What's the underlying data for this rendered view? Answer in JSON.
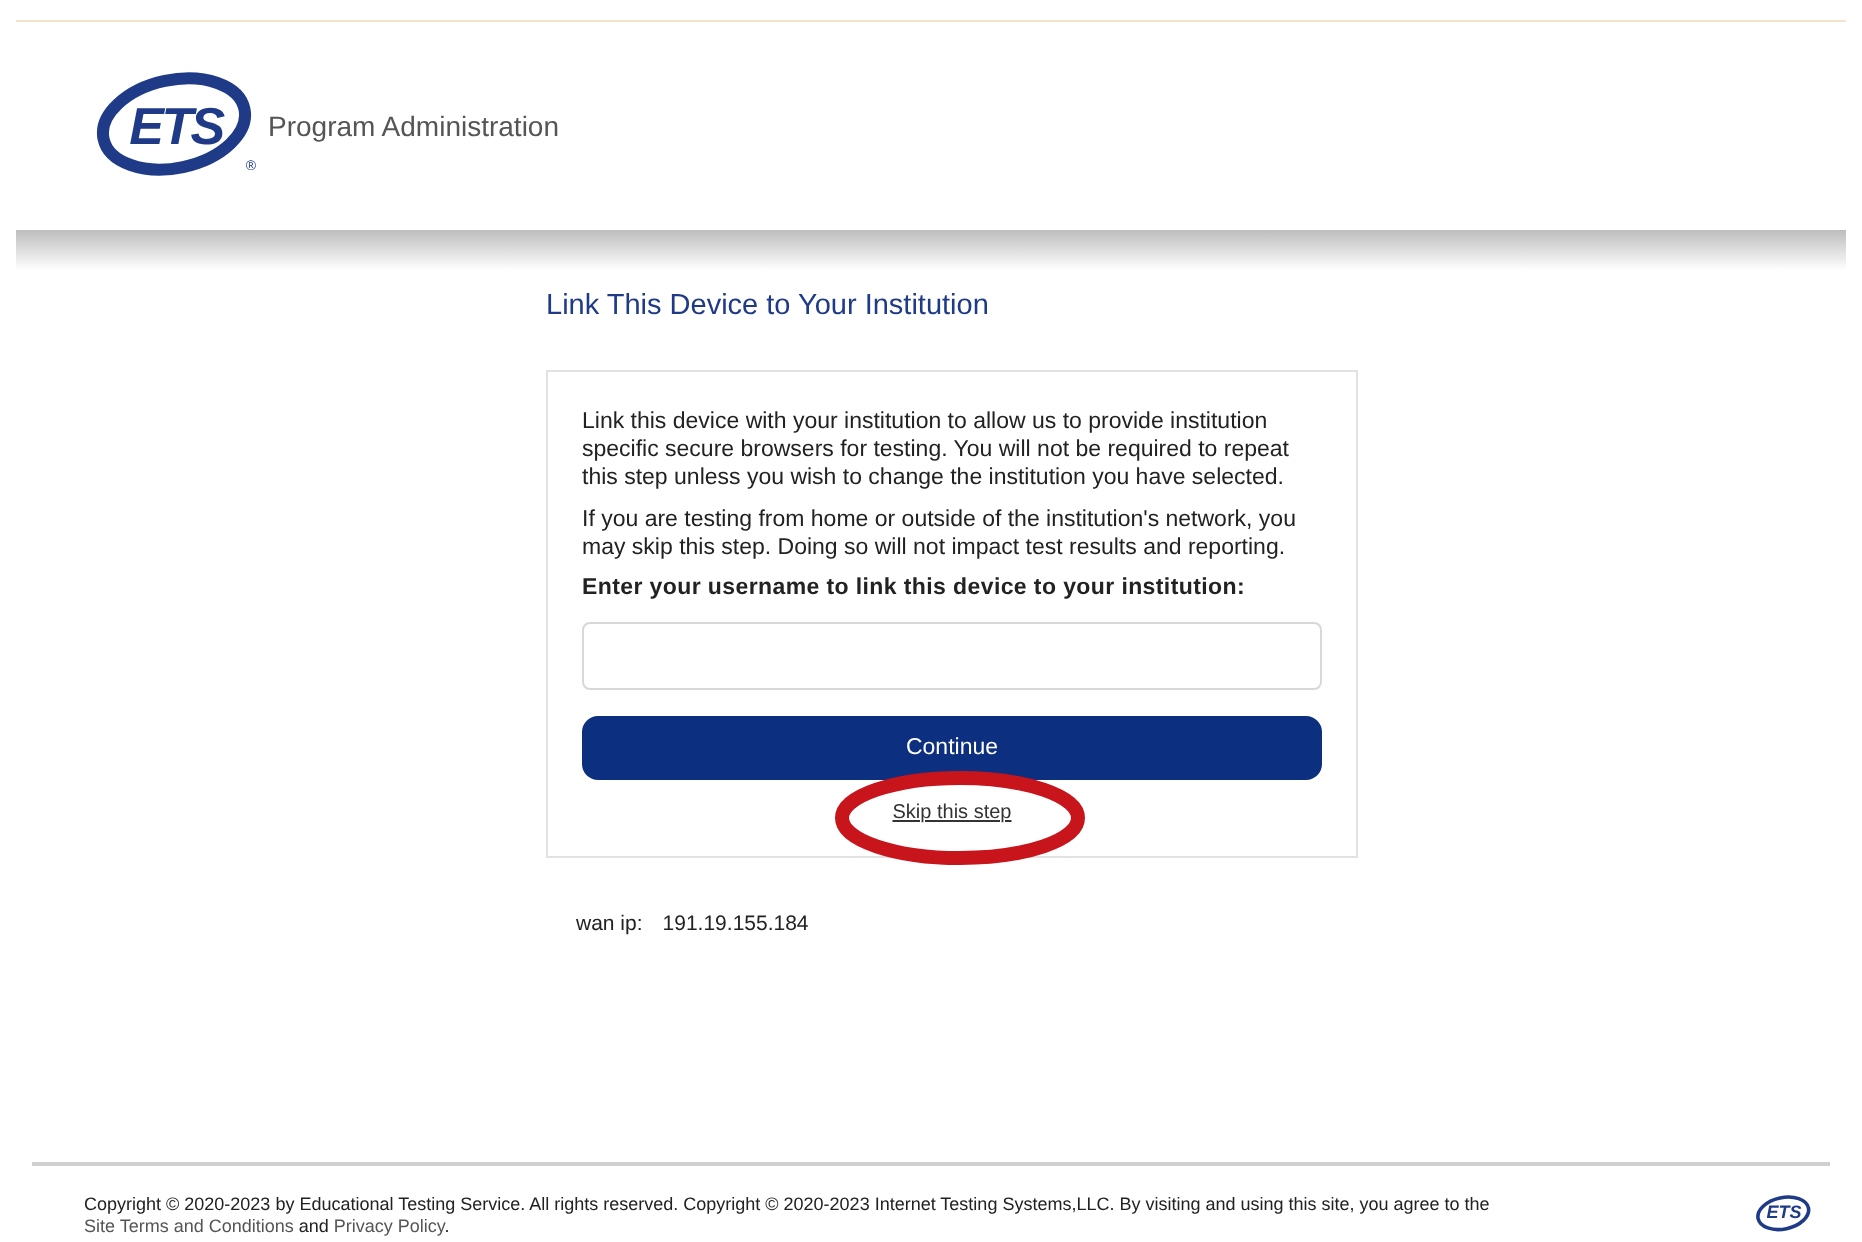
{
  "header": {
    "logo_text": "ETS",
    "logo_mark": "®",
    "title": "Program Administration"
  },
  "main": {
    "heading": "Link This Device to Your Institution",
    "paragraphs": [
      "Link this device with your institution to allow us to provide institution specific secure browsers for testing. You will not be required to repeat this step unless you wish to change the institution you have selected.",
      "If you are testing from home or outside of the institution's network, you may skip this step. Doing so will not impact test results and reporting."
    ],
    "field_label": "Enter your username to link this device to your institution:",
    "continue_button": "Continue",
    "skip_link": "Skip this step",
    "skip_highlighted": true
  },
  "wan_ip": {
    "label": "wan ip:",
    "value": "191.19.155.184"
  },
  "footer": {
    "segments": [
      {
        "kind": "text",
        "text": "Copyright © 2020-2023 by Educational Testing Service. All rights reserved. Copyright © 2020-2023 Internet Testing Systems,LLC. By visiting and using this site, you agree to the "
      },
      {
        "kind": "link",
        "text": "Site Terms and Conditions"
      },
      {
        "kind": "text",
        "text": " and "
      },
      {
        "kind": "link",
        "text": "Privacy Policy"
      },
      {
        "kind": "text",
        "text": "."
      }
    ],
    "logo_text": "ETS"
  }
}
